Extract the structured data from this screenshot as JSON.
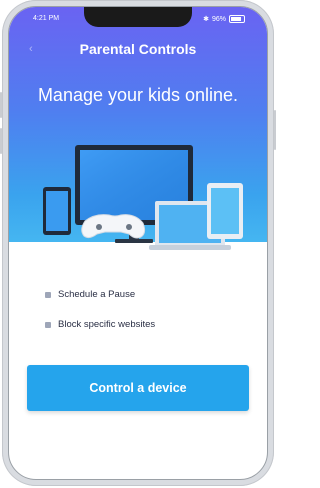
{
  "status_bar": {
    "time": "4:21 PM",
    "battery": "96%"
  },
  "header": {
    "title": "Parental Controls"
  },
  "hero": {
    "headline": "Manage your kids online."
  },
  "features": [
    {
      "label": "Schedule a Pause",
      "icon": "bullet-icon"
    },
    {
      "label": "Block specific websites",
      "icon": "bullet-icon"
    }
  ],
  "cta": {
    "label": "Control a device"
  },
  "colors": {
    "accent": "#25a4ec",
    "hero_top": "#6a63f2",
    "hero_bottom": "#45b6f1"
  }
}
